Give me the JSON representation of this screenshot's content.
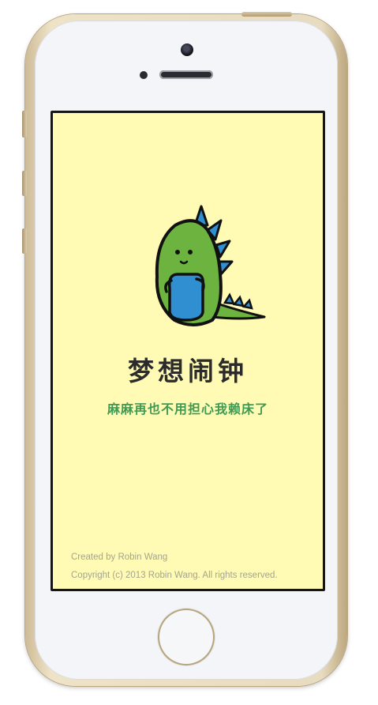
{
  "device": {
    "model": "iPhone",
    "frame_color": "#e8dcc0",
    "screen_background": "#fffbb5"
  },
  "splash": {
    "mascot_icon": "green-dinosaur-mascot",
    "title": "梦想闹钟",
    "subtitle": "麻麻再也不用担心我赖床了",
    "title_color": "#2b2b2b",
    "subtitle_color": "#3f9b53"
  },
  "footer": {
    "created_by": "Created by Robin Wang",
    "copyright": "Copyright (c) 2013 Robin Wang. All rights reserved."
  }
}
